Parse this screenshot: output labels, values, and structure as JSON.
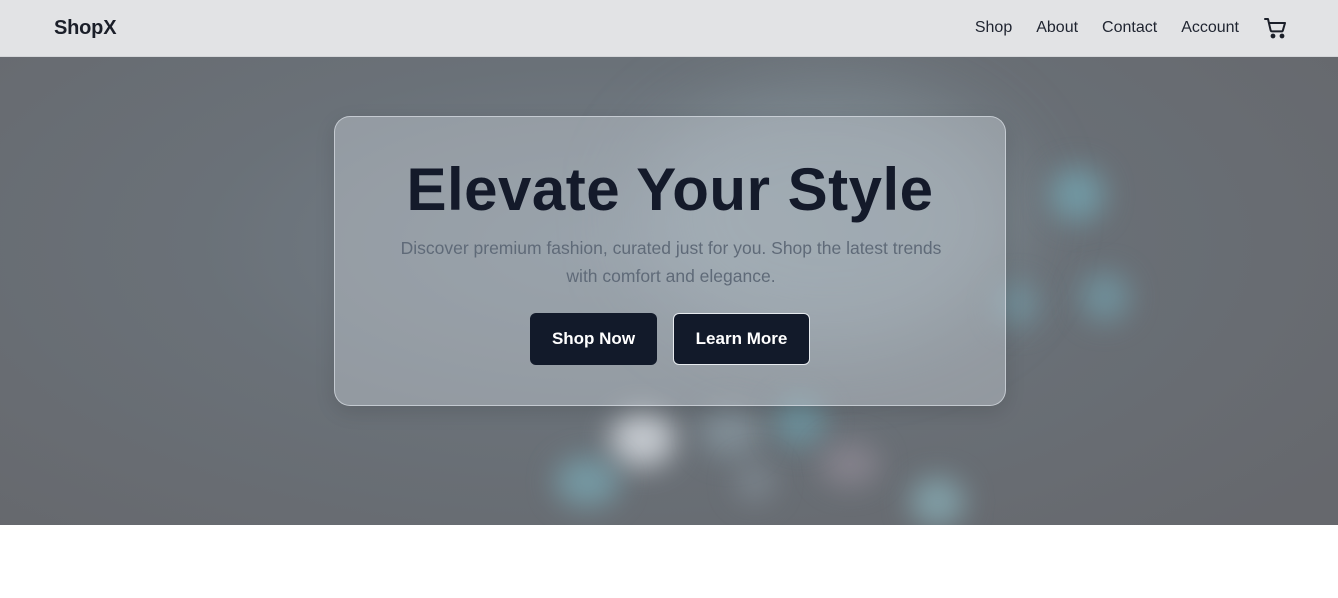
{
  "brand": "ShopX",
  "nav": {
    "links": [
      "Shop",
      "About",
      "Contact",
      "Account"
    ],
    "cart_icon": "cart-icon"
  },
  "hero": {
    "title": "Elevate Your Style",
    "subtitle": "Discover premium fashion, curated just for you. Shop the latest trends with comfort and elegance.",
    "primary_button": "Shop Now",
    "secondary_button": "Learn More"
  },
  "colors": {
    "navbar_bg": "#e2e3e5",
    "button_bg": "#121a2a",
    "title_text": "#141a2a",
    "subtitle_text": "#5f6a78"
  }
}
